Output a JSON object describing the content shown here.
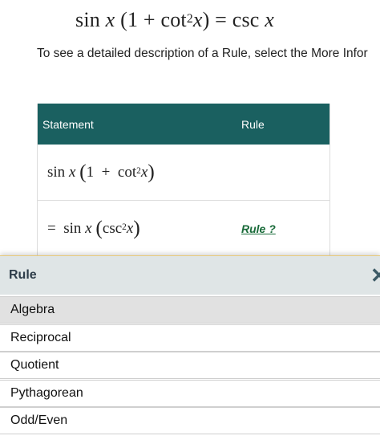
{
  "problem": {
    "lhs_func": "sin",
    "lhs_var": "x",
    "one": "1",
    "plus": "+",
    "cot": "cot",
    "exp": "2",
    "var": "x",
    "equals": "=",
    "rhs_func": "csc",
    "rhs_var": "x"
  },
  "instruction": "To see a detailed description of a Rule, select the More Infor",
  "table": {
    "header_statement": "Statement",
    "header_rule": "Rule",
    "row1": {
      "func": "sin",
      "var": "x",
      "one": "1",
      "plus": "+",
      "cot": "cot",
      "exp": "2",
      "inner_var": "x"
    },
    "row2": {
      "eq": "=",
      "func": "sin",
      "var": "x",
      "csc": "csc",
      "exp": "2",
      "inner_var": "x",
      "rule_link": "Rule ?"
    }
  },
  "rule_panel": {
    "title": "Rule",
    "close_icon": "close-icon",
    "items": [
      "Algebra",
      "Reciprocal",
      "Quotient",
      "Pythagorean",
      "Odd/Even"
    ],
    "selected_index": 0
  },
  "colors": {
    "header_bg": "#1a6060",
    "link": "#1a6b3a",
    "panel_header_bg": "#dfe5e6",
    "selected_bg": "#e1e1e1"
  }
}
